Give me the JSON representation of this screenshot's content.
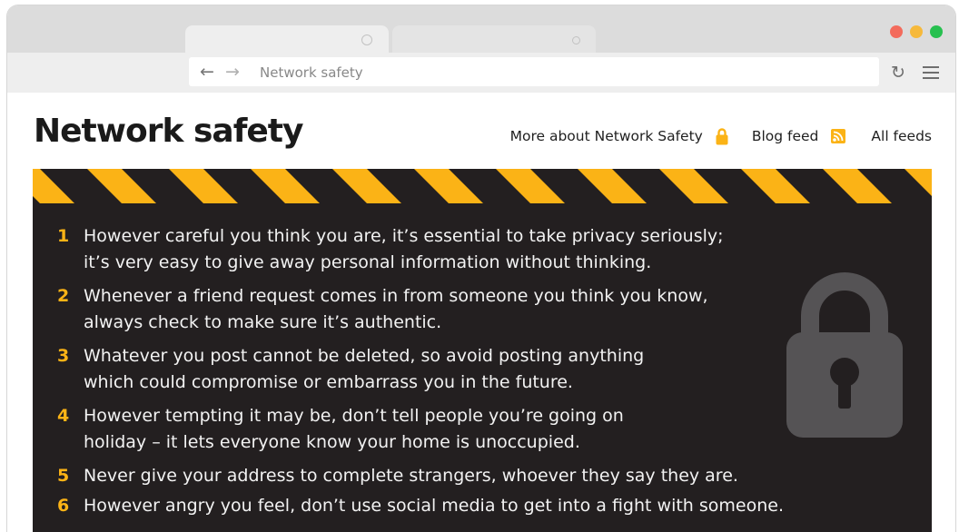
{
  "browser": {
    "url_text": "Network safety"
  },
  "page": {
    "title": "Network safety",
    "links": {
      "more_about": "More about Network Safety",
      "blog_feed": "Blog feed",
      "all_feeds": "All feeds"
    }
  },
  "tips": [
    {
      "number": "1",
      "text": "However careful you think you are, it’s essential to take privacy seriously;\nit’s very easy to give away personal information without thinking."
    },
    {
      "number": "2",
      "text": "Whenever a friend request comes in from someone you think you know,\nalways check to make sure it’s authentic."
    },
    {
      "number": "3",
      "text": "Whatever you post cannot be deleted, so avoid posting anything\nwhich could compromise or embarrass you in the future."
    },
    {
      "number": "4",
      "text": "However tempting it may be, don’t tell people you’re going on\nholiday – it lets everyone know your home is unoccupied."
    },
    {
      "number": "5",
      "text": "Never give your address to complete strangers, whoever they say they are."
    },
    {
      "number": "6",
      "text": "However angry you feel, don’t use social media to get into a fight with someone."
    }
  ],
  "icons": {
    "back": "arrow-left-icon",
    "forward": "arrow-right-icon",
    "reload": "reload-icon",
    "menu": "hamburger-menu-icon",
    "lock": "padlock-icon",
    "rss": "rss-icon"
  },
  "colors": {
    "accent_yellow": "#fbb316",
    "panel_dark": "#231f20",
    "traffic_red": "#f36b5c",
    "traffic_yellow": "#f6b93b",
    "traffic_green": "#27c04f"
  }
}
